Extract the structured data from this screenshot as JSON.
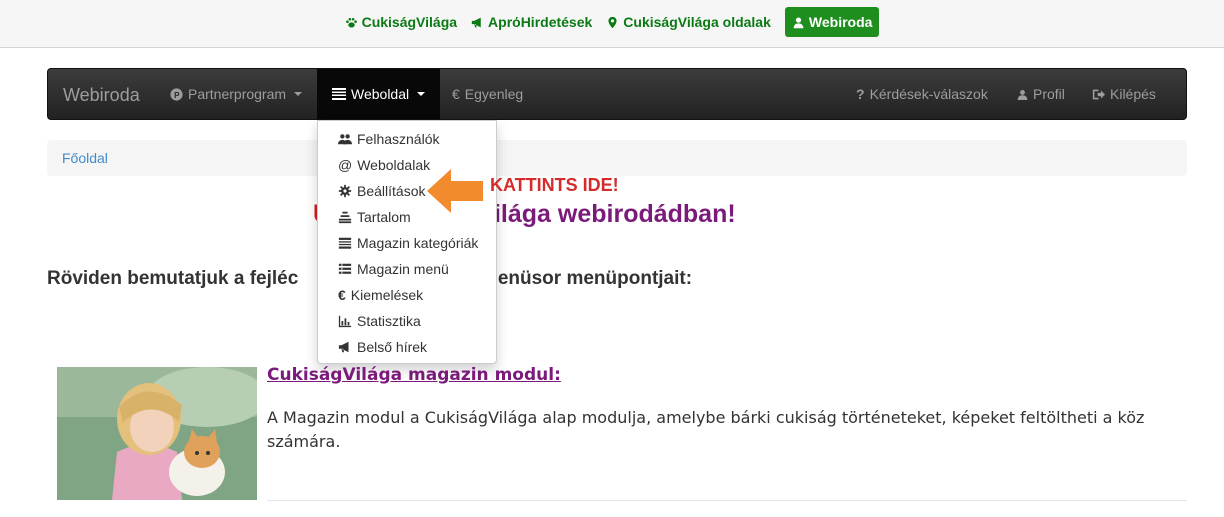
{
  "topbar": {
    "links": [
      {
        "label": "CukiságVilága",
        "icon": "paw-icon"
      },
      {
        "label": "APRÓHirdetések",
        "icon": "bullhorn-icon"
      },
      {
        "label": "CukiságVilága oldalak",
        "icon": "map-marker-icon"
      },
      {
        "label": "Webiroda",
        "icon": "user-icon",
        "active": true
      }
    ]
  },
  "navbar": {
    "brand": "Webiroda",
    "items": [
      {
        "label": "Partnerprogram",
        "icon": "p-circle-icon"
      },
      {
        "label": "Weboldal",
        "icon": "list-icon"
      },
      {
        "label": "Egyenleg",
        "icon": "euro-icon"
      },
      {
        "label": "Kérdések-válaszok",
        "icon": "question-icon"
      },
      {
        "label": "Profil",
        "icon": "user-icon"
      },
      {
        "label": "Kilépés",
        "icon": "logout-icon"
      }
    ]
  },
  "dropdown": {
    "items": [
      {
        "label": "Felhasználók",
        "icon": "users-icon"
      },
      {
        "label": "Weboldalak",
        "icon": "at-icon"
      },
      {
        "label": "Beállítások",
        "icon": "gear-icon"
      },
      {
        "label": "Tartalom",
        "icon": "align-center-icon"
      },
      {
        "label": "Magazin kategóriák",
        "icon": "list-alt-icon"
      },
      {
        "label": "Magazin menü",
        "icon": "list-icon"
      },
      {
        "label": "Kiemelések",
        "icon": "euro-icon"
      },
      {
        "label": "Statisztika",
        "icon": "bar-chart-icon"
      },
      {
        "label": "Belső hírek",
        "icon": "bullhorn-icon"
      }
    ]
  },
  "callout": "KATTINTS IDE!",
  "breadcrumb": "Főoldal",
  "welcome": {
    "pre": "Ü",
    "text": "z CukiságVilága webirodádban!"
  },
  "intro": "Röviden bemutatjuk a fejléc                    legfelső menüsor menüpontjait:",
  "article": {
    "title": "CukiságVilága magazin modul:",
    "text": "A Magazin modul a CukiságVilága alap modulja, amelybe bárki cukiság történeteket, képeket feltöltheti a köz számára."
  },
  "colors": {
    "green": "#1e8f1e",
    "purple": "#7a1a7a",
    "red": "#d62b2b",
    "orange": "#f28a2e"
  }
}
